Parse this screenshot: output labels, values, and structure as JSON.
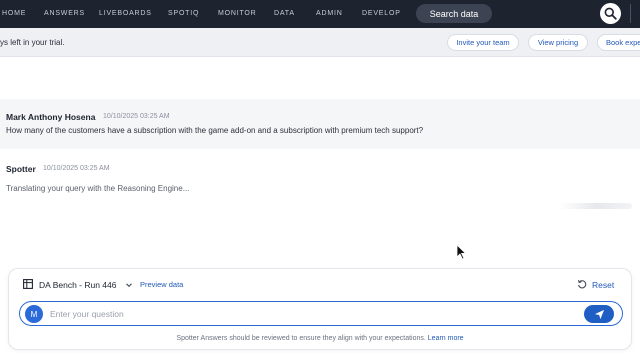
{
  "nav": {
    "items": [
      "HOME",
      "ANSWERS",
      "LIVEBOARDS",
      "SPOTIQ",
      "MONITOR",
      "DATA",
      "ADMIN",
      "DEVELOP"
    ],
    "search_button": "Search data",
    "bg_color": "#1d232f"
  },
  "trial": {
    "text": "ys left in your trial.",
    "buttons": [
      "Invite your team",
      "View pricing",
      "Book expe"
    ]
  },
  "conversation": {
    "user": {
      "name": "Mark Anthony Hosena",
      "time": "10/10/2025 03:25 AM",
      "question": "How many of the customers have a subscription with the game add-on and a subscription with premium tech support?"
    },
    "bot": {
      "name": "Spotter",
      "time": "10/10/2025 03:25 AM",
      "status": "Translating your query with the Reasoning Engine..."
    }
  },
  "composer": {
    "datasource": "DA Bench - Run 446",
    "preview_label": "Preview data",
    "reset_label": "Reset",
    "avatar_initial": "M",
    "placeholder": "Enter your question",
    "disclaimer": "Spotter Answers should be reviewed to ensure they align with your expectations.",
    "learn_more": "Learn more",
    "accent_color": "#2b6ad9"
  },
  "icons": {
    "nav_search": "search-icon",
    "datasource": "table-icon",
    "chevron": "chevron-down-icon",
    "reset": "reset-icon",
    "send": "send-icon",
    "cursor": "mouse-pointer-icon"
  }
}
